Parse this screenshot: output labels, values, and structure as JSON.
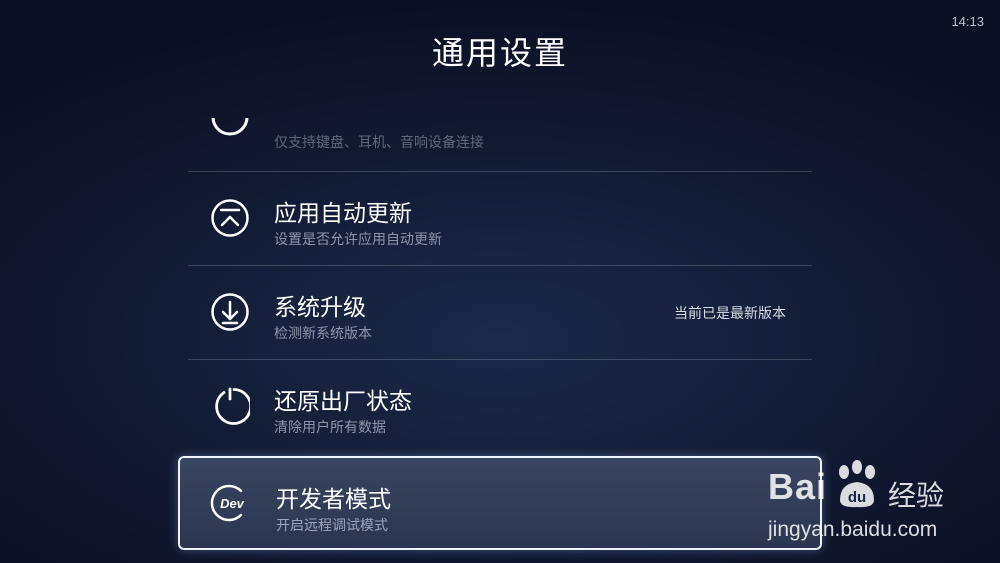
{
  "status_bar": {
    "time": "14:13"
  },
  "page_title": "通用设置",
  "items": [
    {
      "label": "",
      "description": "仅支持键盘、耳机、音响设备连接",
      "icon": "device-icon",
      "state": "partially-scrolled"
    },
    {
      "label": "应用自动更新",
      "description": "设置是否允许应用自动更新",
      "icon": "auto-update-icon"
    },
    {
      "label": "系统升级",
      "description": "检测新系统版本",
      "value": "当前已是最新版本",
      "icon": "download-icon"
    },
    {
      "label": "还原出厂状态",
      "description": "清除用户所有数据",
      "icon": "restore-icon"
    },
    {
      "label": "开发者模式",
      "description": "开启远程调试模式",
      "icon": "dev-icon",
      "state": "focused"
    }
  ],
  "watermark": {
    "logo": "Bai",
    "logo_suffix": "经验",
    "url": "jingyan.baidu.com"
  }
}
